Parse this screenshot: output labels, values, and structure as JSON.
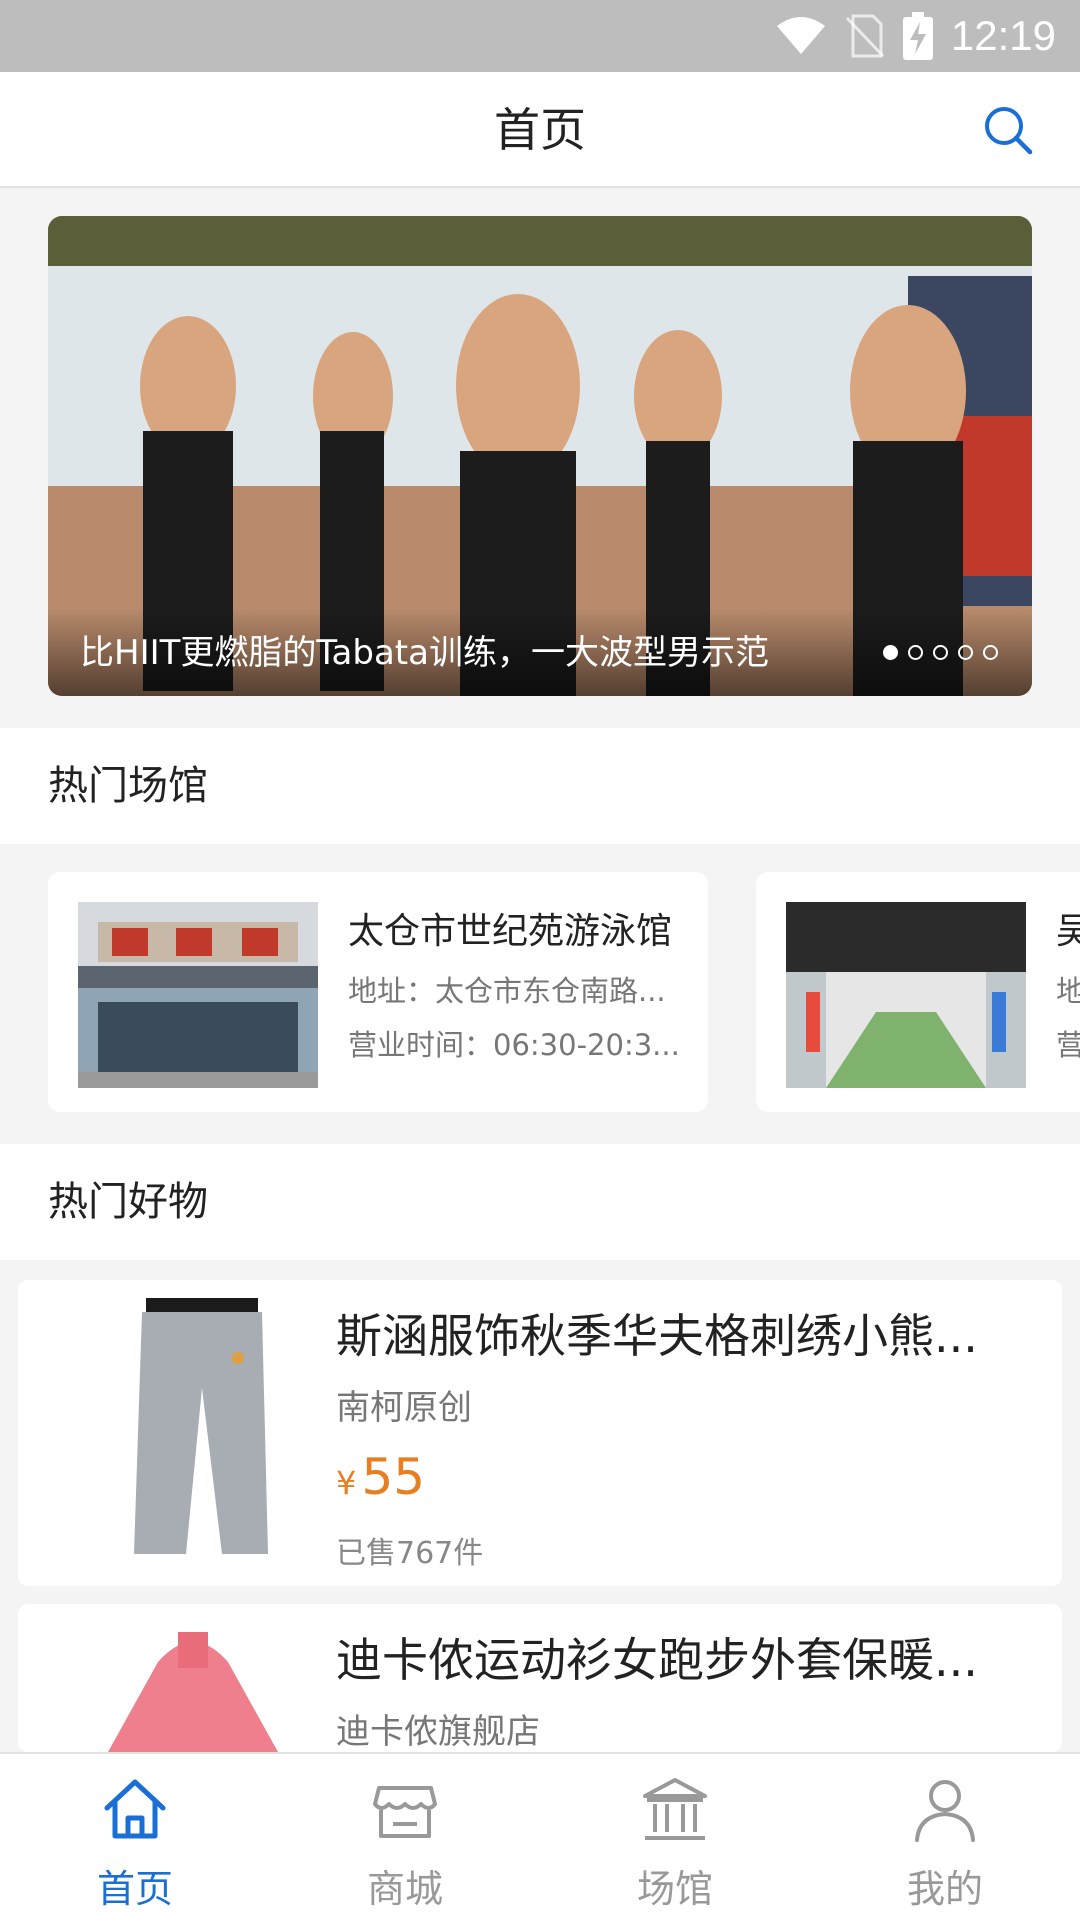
{
  "status_bar": {
    "time": "12:19"
  },
  "header": {
    "title": "首页"
  },
  "banner": {
    "caption": "比HIIT更燃脂的Tabata训练，一大波型男示范",
    "slide_count": 5,
    "active_slide": 1
  },
  "venues_section": {
    "title": "热门场馆"
  },
  "venues": [
    {
      "name": "太仓市世纪苑游泳馆",
      "address": "地址：太仓市东仓南路...",
      "hours": "营业时间：06:30-20:3..."
    },
    {
      "name": "吴",
      "address": "地",
      "hours": "营"
    }
  ],
  "goods_section": {
    "title": "热门好物"
  },
  "products": [
    {
      "name": "斯涵服饰秋季华夫格刺绣小熊...",
      "shop": "南柯原创",
      "price_symbol": "¥",
      "price": "55",
      "sold": "已售767件"
    },
    {
      "name": "迪卡侬运动衫女跑步外套保暖...",
      "shop": "迪卡侬旗舰店"
    }
  ],
  "tabs": [
    {
      "label": "首页",
      "icon": "home-icon",
      "active": true
    },
    {
      "label": "商城",
      "icon": "shop-icon",
      "active": false
    },
    {
      "label": "场馆",
      "icon": "venue-icon",
      "active": false
    },
    {
      "label": "我的",
      "icon": "profile-icon",
      "active": false
    }
  ],
  "colors": {
    "accent": "#1a6fd6",
    "price": "#e67e22",
    "status_bar": "#bdbdbd"
  }
}
